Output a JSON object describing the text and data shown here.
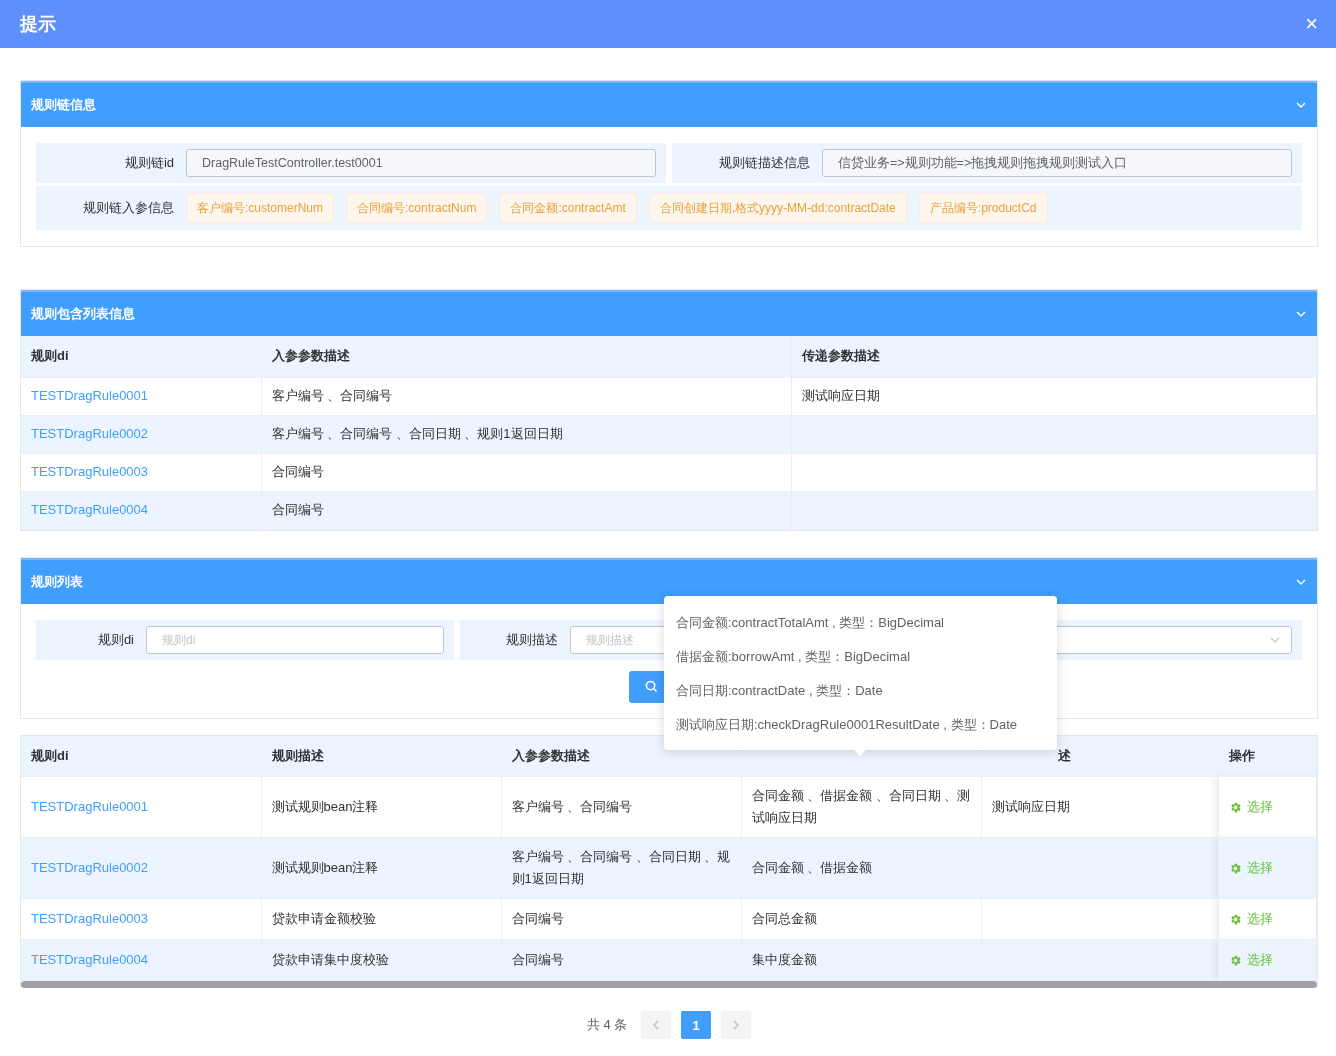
{
  "dialog": {
    "title": "提示",
    "close": "×"
  },
  "chain_panel": {
    "title": "规则链信息",
    "fields": [
      {
        "label": "规则链id",
        "value": "DragRuleTestController.test0001"
      },
      {
        "label": "规则链描述信息",
        "value": "信贷业务=>规则功能=>拖拽规则拖拽规则测试入口"
      }
    ],
    "params_label": "规则链入参信息",
    "params": [
      "客户编号:customerNum",
      "合同编号:contractNum",
      "合同金额:contractAmt",
      "合同创建日期,格式yyyy-MM-dd:contractDate",
      "产品编号:productCd"
    ]
  },
  "included_panel": {
    "title": "规则包含列表信息",
    "columns": [
      "规则di",
      "入参参数描述",
      "传递参数描述"
    ],
    "rows": [
      [
        "TESTDragRule0001",
        "客户编号 、合同编号",
        "测试响应日期"
      ],
      [
        "TESTDragRule0002",
        "客户编号 、合同编号 、合同日期 、规则1返回日期",
        null
      ],
      [
        "TESTDragRule0003",
        "合同编号",
        null
      ],
      [
        "TESTDragRule0004",
        "合同编号",
        null
      ]
    ]
  },
  "rule_list_panel": {
    "title": "规则列表",
    "filters": [
      {
        "kind": "input",
        "label": "规则di",
        "placeholder": "规则di"
      },
      {
        "kind": "input",
        "label": "规则描述",
        "placeholder": "规则描述"
      },
      {
        "kind": "select"
      }
    ]
  },
  "rule_table": {
    "columns": [
      {
        "label": "规则di"
      },
      {
        "label": "规则描述"
      },
      {
        "label": "入参参数描述"
      },
      {},
      {
        "label": "述"
      },
      {
        "label": "操作"
      }
    ],
    "rows": [
      {
        "cells": [
          "TESTDragRule0001",
          "测试规则bean注释",
          "客户编号 、合同编号",
          "合同金额 、借据金额 、合同日期 、测试响应日期",
          "测试响应日期"
        ],
        "action": "选择"
      },
      {
        "cells": [
          "TESTDragRule0002",
          "测试规则bean注释",
          "客户编号 、合同编号 、合同日期 、规则1返回日期",
          "合同金额 、借据金额",
          null
        ],
        "action": "选择"
      },
      {
        "cells": [
          "TESTDragRule0003",
          "贷款申请金额校验",
          "合同编号",
          "合同总金额",
          null
        ],
        "action": "选择"
      },
      {
        "cells": [
          "TESTDragRule0004",
          "贷款申请集中度校验",
          "合同编号",
          "集中度金额",
          null
        ],
        "action": "选择"
      }
    ]
  },
  "pagination": {
    "total": "共 4 条",
    "pages": [
      {
        "label": "1",
        "selected": true
      }
    ]
  },
  "tooltip": {
    "lines": [
      "合同金额:contractTotalAmt , 类型：BigDecimal",
      "借据金额:borrowAmt , 类型：BigDecimal",
      "合同日期:contractDate , 类型：Date",
      "测试响应日期:checkDragRule0001ResultDate , 类型：Date"
    ]
  }
}
